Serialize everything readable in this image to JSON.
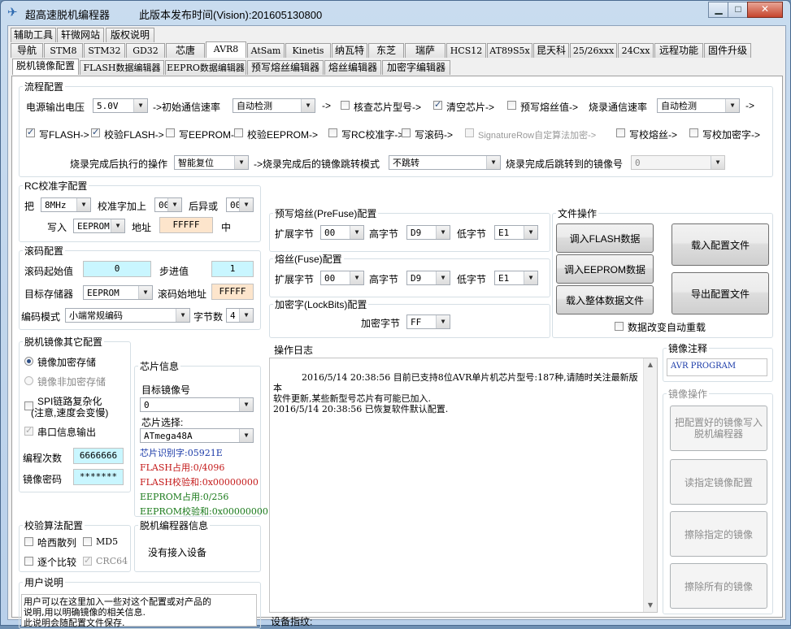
{
  "window": {
    "title": "超高速脱机编程器",
    "version": "此版本发布时间(Vision):201605130800",
    "min_icon": "minimize-icon",
    "max_icon": "maximize-icon",
    "close_icon": "close-icon"
  },
  "top_tabs": [
    "辅助工具",
    "轩微网站",
    "版权说明"
  ],
  "chip_tabs": [
    "导航",
    "STM8",
    "STM32",
    "GD32",
    "芯唐",
    "AVR8",
    "AtSam",
    "Kinetis",
    "纳瓦特",
    "东芝",
    "瑞萨",
    "HCS12",
    "AT89S5x",
    "昆天科",
    "25/26xxx",
    "24Cxx",
    "远程功能",
    "固件升级"
  ],
  "chip_tab_selected": "AVR8",
  "sub_tabs": [
    "脱机镜像配置",
    "FLASH数据编辑器",
    "EEPRO数据编辑器",
    "预写熔丝编辑器",
    "熔丝编辑器",
    "加密字编辑器"
  ],
  "sub_tab_selected": "脱机镜像配置",
  "flow": {
    "title": "流程配置",
    "voltage_label": "电源输出电压",
    "voltage_value": "5.0V",
    "init_speed_label": "->初始通信速率",
    "init_speed_value": "自动检测",
    "arrow": "->",
    "check_chip": "核查芯片型号->",
    "clear_chip": "清空芯片->",
    "prewrite_fuse": "预写熔丝值->",
    "burn_speed_label": "烧录通信速率",
    "burn_speed_value": "自动检测",
    "write_flash": "写FLASH->",
    "verify_flash": "校验FLASH->",
    "write_eeprom": "写EEPROM->",
    "verify_eeprom": "校验EEPROM->",
    "write_rc": "写RC校准字->",
    "write_rolling": "写滚码->",
    "sigrow": "SignatureRow自定算法加密->",
    "write_verify_fuse": "写校熔丝->",
    "write_lock": "写校加密字->",
    "after_label": "烧录完成后执行的操作",
    "after_value": "智能复位",
    "jump_mode_label": "->烧录完成后的镜像跳转模式",
    "jump_mode_value": "不跳转",
    "jump_target_label": "烧录完成后跳转到的镜像号",
    "jump_target_value": "0"
  },
  "rc": {
    "title": "RC校准字配置",
    "ba": "把",
    "freq": "8MHz",
    "add_label": "校准字加上",
    "add_value": "00",
    "xor_label": "后异或",
    "xor_value": "00",
    "write_label": "写入",
    "target": "EEPROM",
    "addr_label": "地址",
    "addr_value": "FFFFF",
    "zhong": "中"
  },
  "rolling": {
    "title": "滚码配置",
    "start_label": "滚码起始值",
    "start_value": "0",
    "step_label": "步进值",
    "step_value": "1",
    "target_label": "目标存储器",
    "target_value": "EEPROM",
    "addr_label": "滚码始地址",
    "addr_value": "FFFFF",
    "mode_label": "编码模式",
    "mode_value": "小端常规编码",
    "bytes_label": "字节数",
    "bytes_value": "4"
  },
  "other": {
    "title": "脱机镜像其它配置",
    "enc": "镜像加密存储",
    "noenc": "镜像非加密存储",
    "spi_line1": "SPI链路复杂化",
    "spi_line2": "(注意,速度会变慢)",
    "serial_out": "串口信息输出",
    "prog_count_label": "编程次数",
    "prog_count_value": "6666666",
    "pwd_label": "镜像密码",
    "pwd_value": "*******"
  },
  "chipinfo": {
    "title": "芯片信息",
    "target_label": "目标镜像号",
    "target_value": "0",
    "chip_label": "芯片选择:",
    "chip_value": "ATmega48A",
    "sig": "芯片识别字:05921E",
    "flash_use": "FLASH占用:0/4096",
    "flash_sum": "FLASH校验和:0x00000000",
    "eeprom_use": "EEPROM占用:0/256",
    "eeprom_sum": "EEPROM校验和:0x00000000",
    "colors": {
      "sig": "#1a3aa8",
      "flash": "#c41a1a",
      "eeprom": "#1a7a1a"
    }
  },
  "checksum": {
    "title": "校验算法配置",
    "hash": "哈西散列",
    "md5": "MD5",
    "each": "逐个比较",
    "crc": "CRC64"
  },
  "programmer": {
    "title": "脱机编程器信息",
    "status": "没有接入设备"
  },
  "user_note": {
    "title": "用户说明",
    "text": "用户可以在这里加入一些对这个配置或对产品的\n说明,用以明确镜像的相关信息.\n此说明会随配置文件保存."
  },
  "prefuse": {
    "title": "预写熔丝(PreFuse)配置",
    "ext_label": "扩展字节",
    "ext_value": "00",
    "high_label": "高字节",
    "high_value": "D9",
    "low_label": "低字节",
    "low_value": "E1"
  },
  "fuse": {
    "title": "熔丝(Fuse)配置",
    "ext_label": "扩展字节",
    "ext_value": "00",
    "high_label": "高字节",
    "high_value": "D9",
    "low_label": "低字节",
    "low_value": "E1"
  },
  "lock": {
    "title": "加密字(LockBits)配置",
    "label": "加密字节",
    "value": "FF"
  },
  "file_ops": {
    "title": "文件操作",
    "load_flash": "调入FLASH数据",
    "load_eeprom": "调入EEPROM数据",
    "load_all": "载入整体数据文件",
    "load_config": "载入配置文件",
    "export_config": "导出配置文件",
    "auto_reload": "数据改变自动重载"
  },
  "log": {
    "title": "操作日志",
    "text": "2016/5/14 20:38:56 目前已支持8位AVR单片机芯片型号:187种,请随时关注最新版本\n软件更新,某些新型号芯片有可能已加入.\n2016/5/14 20:38:56 已恢复软件默认配置.",
    "device_label": "设备指纹:"
  },
  "image_note": {
    "title": "镜像注释",
    "value": "AVR PROGRAM"
  },
  "image_ops": {
    "title": "镜像操作",
    "write": "把配置好的镜像写入\n脱机编程器",
    "read": "读指定镜像配置",
    "erase": "擦除指定的镜像",
    "erase_all": "擦除所有的镜像"
  },
  "icons": {
    "app": "app-logo-icon",
    "dropdown": "chevron-down-icon",
    "check": "checkmark-icon"
  }
}
